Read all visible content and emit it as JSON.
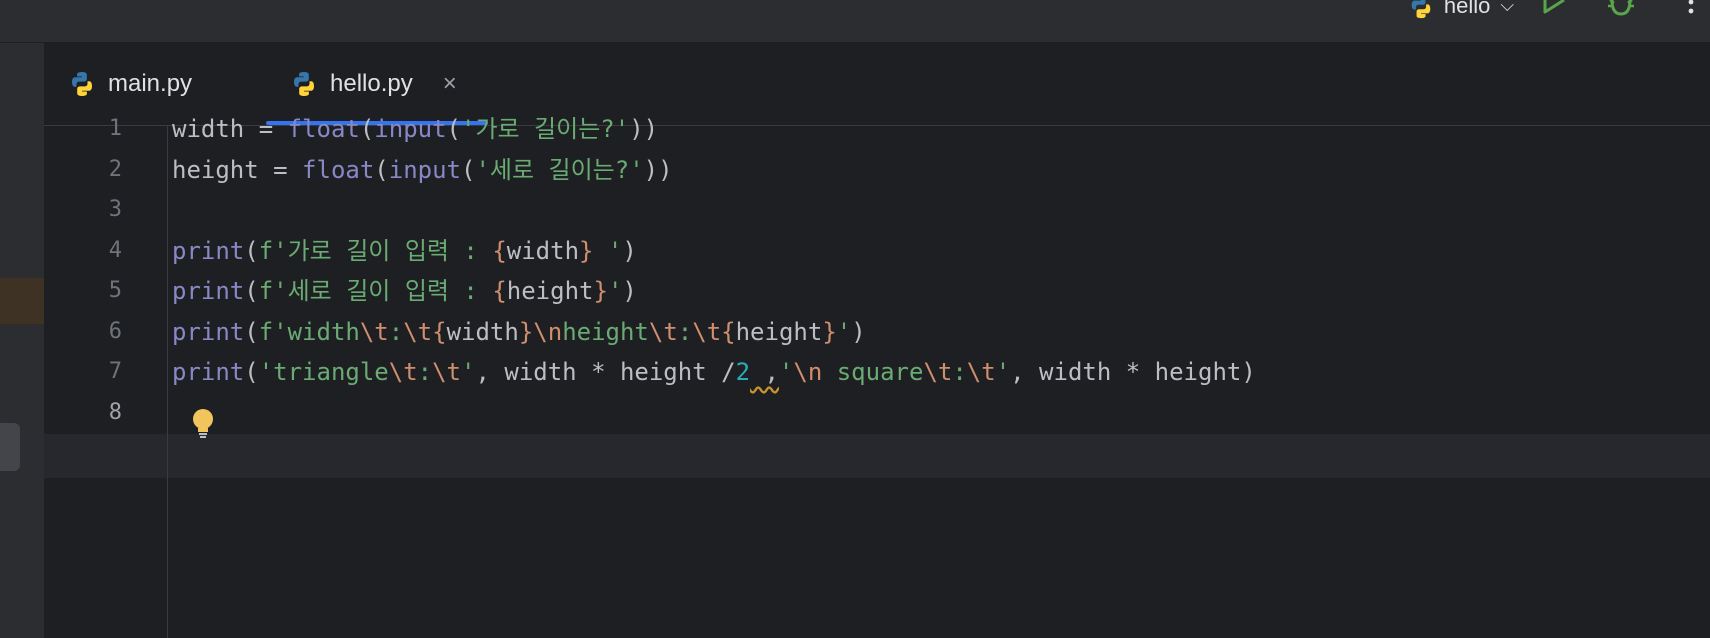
{
  "window": {
    "run_config": "hello",
    "actions": [
      "run-icon",
      "debug-icon",
      "more-icon"
    ]
  },
  "tabs": [
    {
      "label": "main.py",
      "active": false,
      "icon": "python-icon"
    },
    {
      "label": "hello.py",
      "active": true,
      "icon": "python-icon",
      "close": "×"
    }
  ],
  "editor": {
    "line_numbers": [
      "1",
      "2",
      "3",
      "4",
      "5",
      "6",
      "7",
      "8"
    ],
    "current_line": "8",
    "lines": [
      [
        {
          "t": "width = ",
          "c": ""
        },
        {
          "t": "float",
          "c": "kw"
        },
        {
          "t": "(",
          "c": ""
        },
        {
          "t": "input",
          "c": "kw"
        },
        {
          "t": "(",
          "c": ""
        },
        {
          "t": "'가로 길이는?'",
          "c": "str"
        },
        {
          "t": "))",
          "c": ""
        }
      ],
      [
        {
          "t": "height = ",
          "c": ""
        },
        {
          "t": "float",
          "c": "kw"
        },
        {
          "t": "(",
          "c": ""
        },
        {
          "t": "input",
          "c": "kw"
        },
        {
          "t": "(",
          "c": ""
        },
        {
          "t": "'세로 길이는?'",
          "c": "str"
        },
        {
          "t": "))",
          "c": ""
        }
      ],
      [],
      [
        {
          "t": "print",
          "c": "kw"
        },
        {
          "t": "(",
          "c": ""
        },
        {
          "t": "f'가로 길이 입력 : ",
          "c": "str"
        },
        {
          "t": "{",
          "c": "brace"
        },
        {
          "t": "width",
          "c": ""
        },
        {
          "t": "}",
          "c": "brace"
        },
        {
          "t": " '",
          "c": "str"
        },
        {
          "t": ")",
          "c": ""
        }
      ],
      [
        {
          "t": "print",
          "c": "kw"
        },
        {
          "t": "(",
          "c": ""
        },
        {
          "t": "f'세로 길이 입력 : ",
          "c": "str"
        },
        {
          "t": "{",
          "c": "brace"
        },
        {
          "t": "height",
          "c": ""
        },
        {
          "t": "}",
          "c": "brace"
        },
        {
          "t": "'",
          "c": "str"
        },
        {
          "t": ")",
          "c": ""
        }
      ],
      [
        {
          "t": "print",
          "c": "kw"
        },
        {
          "t": "(",
          "c": ""
        },
        {
          "t": "f'width",
          "c": "str"
        },
        {
          "t": "\\t",
          "c": "esc"
        },
        {
          "t": ":",
          "c": "str"
        },
        {
          "t": "\\t",
          "c": "esc"
        },
        {
          "t": "{",
          "c": "brace"
        },
        {
          "t": "width",
          "c": ""
        },
        {
          "t": "}",
          "c": "brace"
        },
        {
          "t": "\\n",
          "c": "esc"
        },
        {
          "t": "height",
          "c": "str"
        },
        {
          "t": "\\t",
          "c": "esc"
        },
        {
          "t": ":",
          "c": "str"
        },
        {
          "t": "\\t",
          "c": "esc"
        },
        {
          "t": "{",
          "c": "brace"
        },
        {
          "t": "height",
          "c": ""
        },
        {
          "t": "}",
          "c": "brace"
        },
        {
          "t": "'",
          "c": "str"
        },
        {
          "t": ")",
          "c": ""
        }
      ],
      [
        {
          "t": "print",
          "c": "kw"
        },
        {
          "t": "(",
          "c": ""
        },
        {
          "t": "'triangle",
          "c": "str"
        },
        {
          "t": "\\t",
          "c": "esc"
        },
        {
          "t": ":",
          "c": "str"
        },
        {
          "t": "\\t",
          "c": "esc"
        },
        {
          "t": "'",
          "c": "str"
        },
        {
          "t": ", width * height /",
          "c": ""
        },
        {
          "t": "2",
          "c": "num"
        },
        {
          "t": " ,",
          "c": "warn"
        },
        {
          "t": "'",
          "c": "str"
        },
        {
          "t": "\\n",
          "c": "esc"
        },
        {
          "t": " square",
          "c": "str"
        },
        {
          "t": "\\t",
          "c": "esc"
        },
        {
          "t": ":",
          "c": "str"
        },
        {
          "t": "\\t",
          "c": "esc"
        },
        {
          "t": "'",
          "c": "str"
        },
        {
          "t": ", width * height)",
          "c": ""
        }
      ],
      []
    ]
  },
  "colors": {
    "keyword": "#8888c6",
    "string": "#6aab73",
    "escape": "#cf8e6d",
    "number": "#2aacb8",
    "accent": "#3574f0"
  }
}
